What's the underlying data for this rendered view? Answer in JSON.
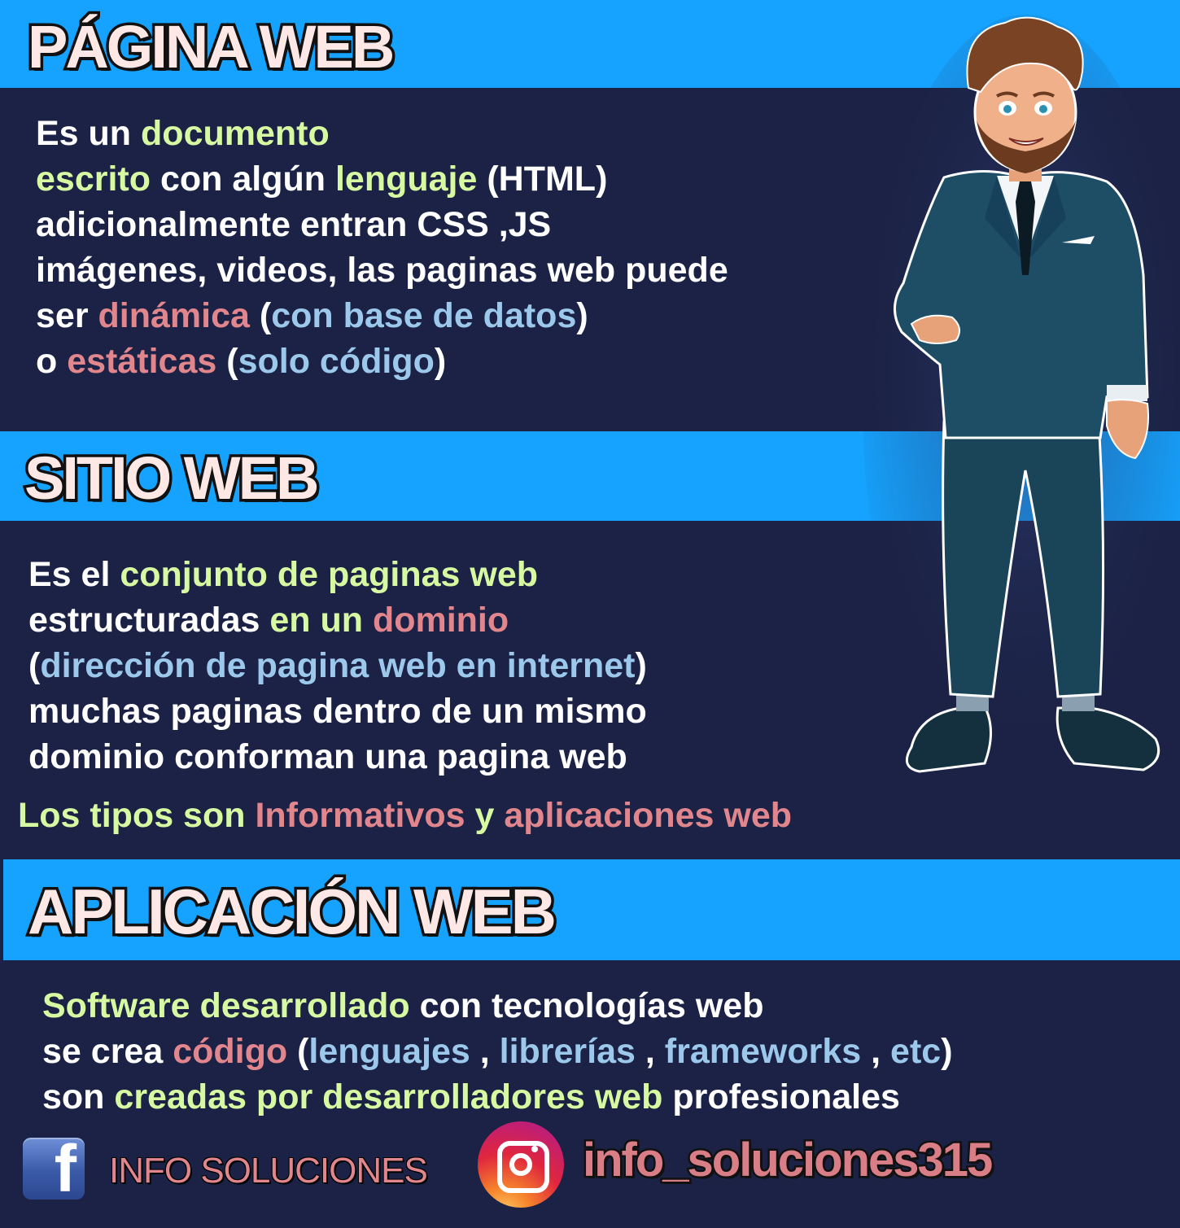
{
  "sections": {
    "pagina": {
      "title": "PÁGINA WEB",
      "lines": [
        [
          {
            "t": "Es un ",
            "c": "w"
          },
          {
            "t": "documento",
            "c": "g"
          }
        ],
        [
          {
            "t": "escrito",
            "c": "g"
          },
          {
            "t": " con algún ",
            "c": "w"
          },
          {
            "t": "lenguaje",
            "c": "g"
          },
          {
            "t": " (HTML)",
            "c": "w"
          }
        ],
        [
          {
            "t": "adicionalmente entran CSS ,JS",
            "c": "w"
          }
        ],
        [
          {
            "t": "imágenes, videos, las paginas web puede",
            "c": "w"
          }
        ],
        [
          {
            "t": "ser ",
            "c": "w"
          },
          {
            "t": "dinámica",
            "c": "p"
          },
          {
            "t": " (",
            "c": "w"
          },
          {
            "t": "con base de datos",
            "c": "b"
          },
          {
            "t": ")",
            "c": "w"
          }
        ],
        [
          {
            "t": "o ",
            "c": "w"
          },
          {
            "t": "estáticas",
            "c": "p"
          },
          {
            "t": " (",
            "c": "w"
          },
          {
            "t": "solo código",
            "c": "b"
          },
          {
            "t": ")",
            "c": "w"
          }
        ]
      ]
    },
    "sitio": {
      "title": "SITIO WEB",
      "lines": [
        [
          {
            "t": "Es el ",
            "c": "w"
          },
          {
            "t": "conjunto de paginas web",
            "c": "g"
          }
        ],
        [
          {
            "t": "estructuradas ",
            "c": "w"
          },
          {
            "t": "en un ",
            "c": "g"
          },
          {
            "t": "dominio",
            "c": "p"
          }
        ],
        [
          {
            "t": "(",
            "c": "w"
          },
          {
            "t": "dirección de pagina web en internet",
            "c": "b"
          },
          {
            "t": ")",
            "c": "w"
          }
        ],
        [
          {
            "t": "muchas paginas dentro de un mismo",
            "c": "w"
          }
        ],
        [
          {
            "t": "dominio conforman una pagina web",
            "c": "w"
          }
        ]
      ],
      "types": [
        {
          "t": "Los tipos son ",
          "c": "g"
        },
        {
          "t": "Informativos",
          "c": "p"
        },
        {
          "t": " y ",
          "c": "g"
        },
        {
          "t": "aplicaciones web",
          "c": "p"
        }
      ]
    },
    "aplicacion": {
      "title": "APLICACIÓN WEB",
      "lines": [
        [
          {
            "t": "Software desarrollado",
            "c": "g"
          },
          {
            "t": " con tecnologías web",
            "c": "w"
          }
        ],
        [
          {
            "t": "se crea ",
            "c": "w"
          },
          {
            "t": "código",
            "c": "p"
          },
          {
            "t": " (",
            "c": "w"
          },
          {
            "t": "lenguajes",
            "c": "b"
          },
          {
            "t": " , ",
            "c": "w"
          },
          {
            "t": "librerías",
            "c": "b"
          },
          {
            "t": " , ",
            "c": "w"
          },
          {
            "t": "frameworks",
            "c": "b"
          },
          {
            "t": " , ",
            "c": "w"
          },
          {
            "t": "etc",
            "c": "b"
          },
          {
            "t": ")",
            "c": "w"
          }
        ],
        [
          {
            "t": "son ",
            "c": "w"
          },
          {
            "t": "creadas por desarrolladores web",
            "c": "g"
          },
          {
            "t": " profesionales",
            "c": "w"
          }
        ]
      ]
    }
  },
  "social": {
    "facebook": {
      "icon": "facebook-icon",
      "glyph": "f",
      "name": "INFO SOLUCIONES"
    },
    "instagram": {
      "icon": "instagram-icon",
      "handle": "info_soluciones315"
    }
  },
  "colors": {
    "band": "#16a3ff",
    "background": "#1b2245",
    "green_text": "#d6f9a2",
    "pink_text": "#e2868d",
    "blue_text": "#9cc8ec"
  }
}
